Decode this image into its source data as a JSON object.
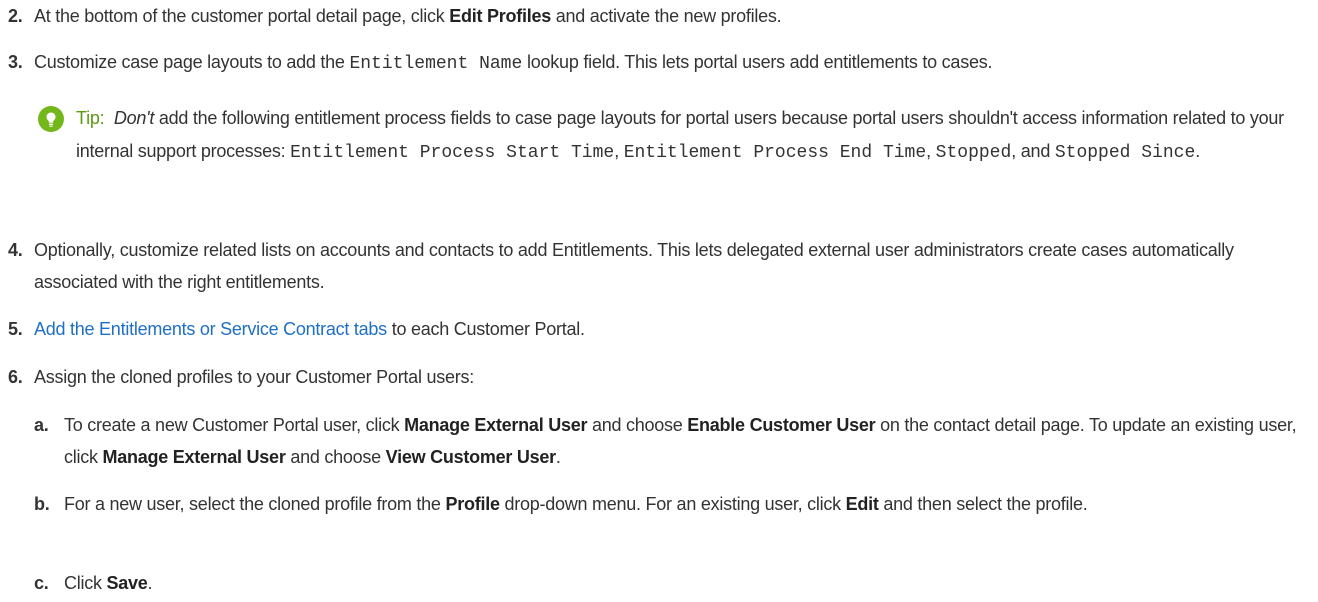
{
  "steps": {
    "s2": {
      "num": "2.",
      "pre": "At the bottom of the customer portal detail page, click ",
      "b1": "Edit Profiles",
      "post": " and activate the new profiles."
    },
    "s3": {
      "num": "3.",
      "pre": "Customize case page layouts to add the ",
      "code": "Entitlement Name",
      "post": " lookup field. This lets portal users add entitlements to cases."
    },
    "tip": {
      "label": "Tip:",
      "em": "Don't",
      "t1": " add the following entitlement process fields to case page layouts for portal users because portal users shouldn't access information related to your internal support processes: ",
      "c1": "Entitlement Process Start Time",
      "sep1": ", ",
      "c2": "Entitlement Process End Time",
      "sep2": ", ",
      "c3": "Stopped",
      "sep3": ", and ",
      "c4": "Stopped Since",
      "end": "."
    },
    "s4": {
      "num": "4.",
      "text": "Optionally, customize related lists on accounts and contacts to add Entitlements. This lets delegated external user administrators create cases automatically associated with the right entitlements."
    },
    "s5": {
      "num": "5.",
      "link": "Add the Entitlements or Service Contract tabs",
      "post": " to each Customer Portal."
    },
    "s6": {
      "num": "6.",
      "text": "Assign the cloned profiles to your Customer Portal users:"
    },
    "a": {
      "num": "a.",
      "t1": "To create a new Customer Portal user, click ",
      "b1": "Manage External User",
      "t2": " and choose ",
      "b2": "Enable Customer User",
      "t3": " on the contact detail page. To update an existing user, click ",
      "b3": "Manage External User",
      "t4": " and choose ",
      "b4": "View Customer User",
      "t5": "."
    },
    "b": {
      "num": "b.",
      "t1": "For a new user, select the cloned profile from the ",
      "b1": "Profile",
      "t2": " drop-down menu. For an existing user, click ",
      "b2": "Edit",
      "t3": "  and then select the profile."
    },
    "c": {
      "num": "c.",
      "t1": "Click ",
      "b1": "Save",
      "t2": "."
    }
  },
  "colors": {
    "link": "#1f6fc5",
    "tip_icon": "#74b71b",
    "tip_label": "#5a9a12"
  },
  "icons": {
    "tip": "lightbulb-icon"
  }
}
